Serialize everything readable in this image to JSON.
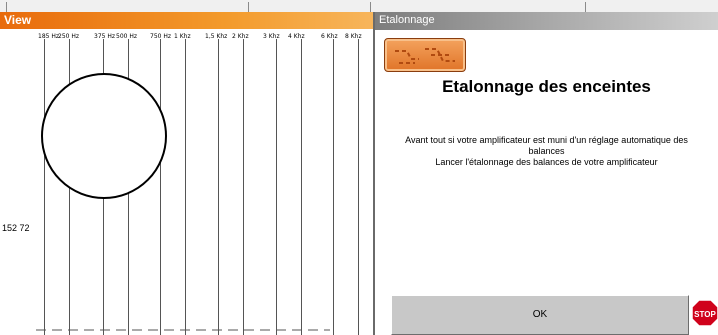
{
  "view": {
    "title": "View",
    "frequency_labels": [
      "185 Hz",
      "250 Hz",
      "375 Hz",
      "500 Hz",
      "750 Hz",
      "1 Khz",
      "1,5 Khz",
      "2 Khz",
      "3 Khz",
      "4 Khz",
      "6 Khz",
      "8 Khz"
    ],
    "side_value": "152 72"
  },
  "etalonnage": {
    "title": "Etalonnage",
    "heading": "Etalonnage des enceintes",
    "description_line1": "Avant tout si votre amplificateur est muni d'un  réglage automatique des",
    "description_line2": "balances",
    "description_line3": "Lancer l'étalonnage des balances de votre amplificateur",
    "ok_label": "OK",
    "stop_label": "STOP"
  },
  "colors": {
    "view_titlebar": "#e86b0c",
    "etal_titlebar": "#8a8a8a",
    "stop_red": "#d0021b"
  }
}
